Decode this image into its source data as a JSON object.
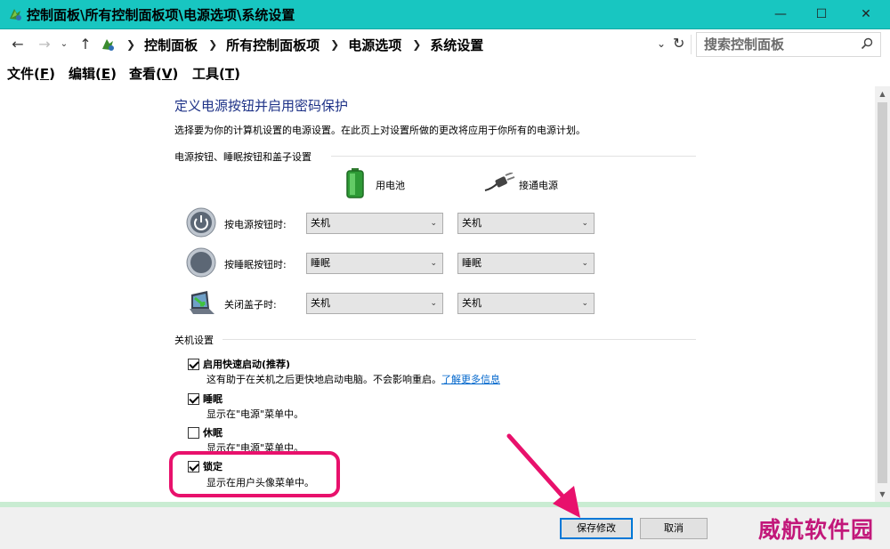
{
  "window": {
    "title": "控制面板\\所有控制面板项\\电源选项\\系统设置",
    "minimize": "—",
    "maximize": "☐",
    "close": "✕"
  },
  "address": {
    "breadcrumbs": [
      "控制面板",
      "所有控制面板项",
      "电源选项",
      "系统设置"
    ],
    "search_placeholder": "搜索控制面板"
  },
  "menu": {
    "file": "文件",
    "file_key": "F",
    "edit": "编辑",
    "edit_key": "E",
    "view": "查看",
    "view_key": "V",
    "tools": "工具",
    "tools_key": "T"
  },
  "page": {
    "title": "定义电源按钮并启用密码保护",
    "description": "选择要为你的计算机设置的电源设置。在此页上对设置所做的更改将应用于你所有的电源计划。"
  },
  "power_buttons": {
    "group_label": "电源按钮、睡眠按钮和盖子设置",
    "col_battery": "用电池",
    "col_plugged": "接通电源",
    "rows": [
      {
        "label": "按电源按钮时:",
        "battery": "关机",
        "plugged": "关机"
      },
      {
        "label": "按睡眠按钮时:",
        "battery": "睡眠",
        "plugged": "睡眠"
      },
      {
        "label": "关闭盖子时:",
        "battery": "关机",
        "plugged": "关机"
      }
    ]
  },
  "shutdown": {
    "group_label": "关机设置",
    "fast_startup": {
      "label": "启用快速启动(推荐)",
      "desc": "这有助于在关机之后更快地启动电脑。不会影响重启。",
      "link": "了解更多信息",
      "checked": true
    },
    "sleep": {
      "label": "睡眠",
      "desc": "显示在\"电源\"菜单中。",
      "checked": true
    },
    "hibernate": {
      "label": "休眠",
      "desc": "显示在\"电源\"菜单中。",
      "checked": false
    },
    "lock": {
      "label": "锁定",
      "desc": "显示在用户头像菜单中。",
      "checked": true
    }
  },
  "footer": {
    "save": "保存修改",
    "cancel": "取消"
  },
  "watermark": "威航软件园",
  "colors": {
    "titlebar": "#18c6c1",
    "heading": "#1e3287",
    "link": "#0066cc",
    "highlight": "#e8116c"
  }
}
